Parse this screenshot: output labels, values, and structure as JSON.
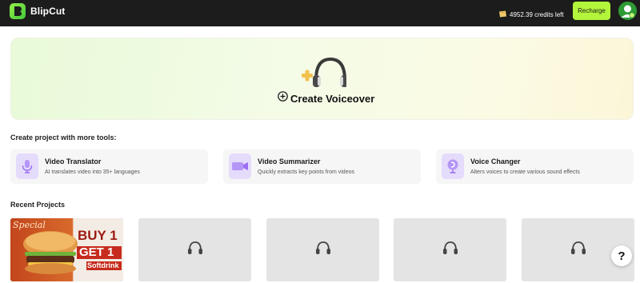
{
  "app": {
    "name": "BlipCut"
  },
  "header": {
    "credits_text": "4952.39 credits left",
    "recharge_label": "Recharge"
  },
  "hero": {
    "cta_label": "Create Voiceover"
  },
  "tools_section": {
    "title": "Create project with more tools:",
    "tools": [
      {
        "title": "Video Translator",
        "desc": "AI translates video into 35+ languages",
        "icon": "microphone-icon"
      },
      {
        "title": "Video Summarizer",
        "desc": "Quickly extracts key points from videos",
        "icon": "video-play-icon"
      },
      {
        "title": "Voice Changer",
        "desc": "Alters voices to create various sound effects",
        "icon": "voice-change-icon"
      }
    ]
  },
  "recent_section": {
    "title": "Recent Projects",
    "first_thumbnail": {
      "line1": "Special",
      "line2": "BUY 1",
      "line3": "GET 1",
      "line4": "Softdrink"
    }
  },
  "colors": {
    "topbar": "#1c1c1c",
    "accent": "#b3f53b",
    "tool_icon_bg": "#e5dbfb",
    "tool_icon_fg": "#9b6ef3"
  }
}
